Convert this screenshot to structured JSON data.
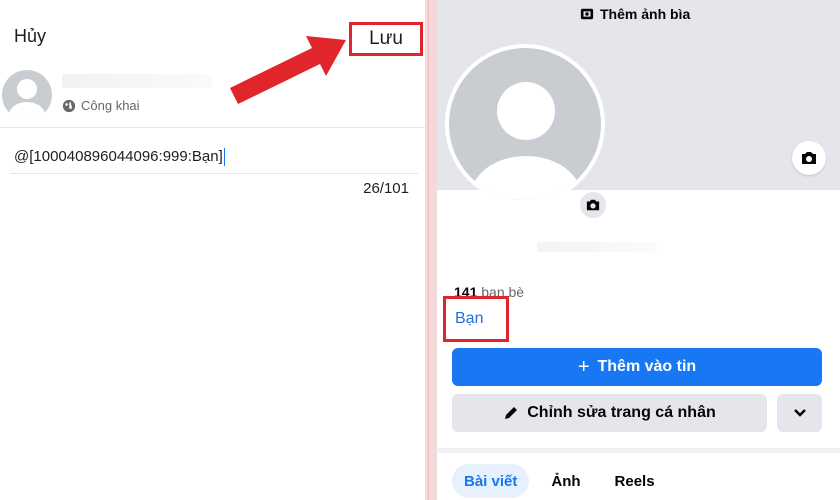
{
  "left_panel": {
    "cancel_label": "Hủy",
    "save_label": "Lưu",
    "privacy_label": "Công khai",
    "nickname_value": "@[100040896044096:999:Bạn]",
    "char_counter": "26/101"
  },
  "right_panel": {
    "cover_button_label": "Thêm ảnh bìa",
    "friends_count": "141",
    "friends_label": "bạn bè",
    "nickname_display": "Bạn",
    "add_story_label": "Thêm vào tin",
    "edit_profile_label": "Chỉnh sửa trang cá nhân",
    "tabs": [
      {
        "label": "Bài viết",
        "active": true
      },
      {
        "label": "Ảnh",
        "active": false
      },
      {
        "label": "Reels",
        "active": false
      }
    ]
  },
  "colors": {
    "highlight_red": "#e0262b",
    "primary_blue": "#1877f2",
    "link_blue": "#216fdb"
  },
  "icons": [
    "globe-icon",
    "camera-icon",
    "cover-photo-icon",
    "plus-icon",
    "pencil-icon",
    "chevron-down-icon"
  ]
}
